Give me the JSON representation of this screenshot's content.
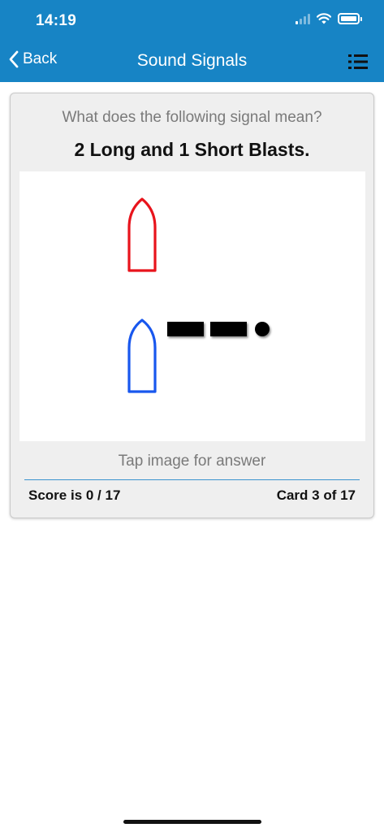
{
  "status_bar": {
    "time": "14:19",
    "icons": [
      "cellular-signal-icon",
      "wifi-icon",
      "battery-icon"
    ]
  },
  "nav": {
    "back_label": "Back",
    "title": "Sound Signals",
    "menu_icon": "list-icon"
  },
  "card": {
    "question": "What does the following signal mean?",
    "signal": "2 Long and 1 Short Blasts.",
    "tap_hint": "Tap image for answer",
    "score": "Score is 0 / 17",
    "card_count": "Card 3 of 17"
  },
  "diagram": {
    "vessels": [
      {
        "role": "other-vessel",
        "color": "#e8141c"
      },
      {
        "role": "signalling-vessel",
        "color": "#1857ee"
      }
    ],
    "blasts": [
      "long",
      "long",
      "short"
    ]
  },
  "colors": {
    "brand": "#1784c5",
    "card_background": "#efefef",
    "divider": "#3a93cf"
  }
}
